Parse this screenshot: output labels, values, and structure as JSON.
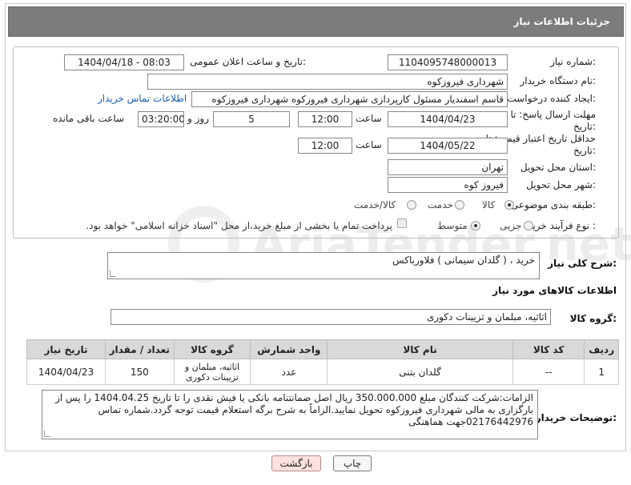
{
  "header": {
    "title": "جزئیات اطلاعات نیاز"
  },
  "form": {
    "need_number_label": "شماره نیاز:",
    "need_number": "1104095748000013",
    "announce_label": "تاریخ و ساعت اعلان عمومی:",
    "announce_value": "1404/04/18 - 08:03",
    "buyer_org_label": "نام دستگاه خریدار:",
    "buyer_org": "شهرداری فیروزکوه",
    "creator_label": "ایجاد کننده درخواست:",
    "creator": "قاسم اسفندیار مسئول کارپردازی شهرداری فیروزکوه شهرداری فیروزکوه",
    "contact_link": "اطلاعات تماس خریدار",
    "deadline_label": "مهلت ارسال پاسخ: تا تاریخ:",
    "deadline_date": "1404/04/23",
    "time_label": "ساعت",
    "deadline_time": "12:00",
    "days_value": "5",
    "days_label": "روز و",
    "remaining_time": "03:20:00",
    "remaining_label": "ساعت باقی مانده",
    "validity_label": "حداقل تاریخ اعتبار قیمت: تا تاریخ:",
    "validity_date": "1404/05/22",
    "validity_time": "12:00",
    "province_label": "استان محل تحویل:",
    "province": "تهران",
    "city_label": "شهر محل تحویل:",
    "city": "فیروز کوه",
    "category_label": "طبقه بندی موضوعی:",
    "category_options": [
      "کالا",
      "خدمت",
      "کالا/خدمت"
    ],
    "category_selected": "کالا",
    "process_label": "نوع فرآیند خرید :",
    "process_options": [
      "جزیی",
      "متوسط"
    ],
    "process_selected": "متوسط",
    "payment_note": "پرداخت تمام یا بخشی از مبلغ خرید،از محل \"اسناد خزانه اسلامی\" خواهد بود."
  },
  "description": {
    "label": "شرح کلی نیاز:",
    "value": "خرید ، ( گلدان سیمانی ) فلاورباکس"
  },
  "goods_section": {
    "title": "اطلاعات کالاهای مورد نیاز",
    "group_label": "گروه کالا:",
    "group_value": "اثاثیه، مبلمان و تزیینات دکوری"
  },
  "table": {
    "headers": [
      "ردیف",
      "کد کالا",
      "نام کالا",
      "واحد شمارش",
      "گروه کالا",
      "تعداد / مقدار",
      "تاریخ نیاز"
    ],
    "rows": [
      [
        "1",
        "--",
        "گلدان بتنی",
        "عدد",
        "اثاثیه، مبلمان و تزیینات دکوری",
        "150",
        "1404/04/23"
      ]
    ]
  },
  "buyer_notes": {
    "label": "توضیحات خریدار:",
    "value": "الزامات:شرکت کنندگان مبلغ 350.000.000 ریال اصل ضمانتنامه بانکی یا فیش نقدی را تا تاریخ 1404.04.25 را پس از بارگزاری به مالی شهرداری فیروزکوه تحویل نمایید.الزاماً به شرح برگه استعلام قیمت توجه گردد.شماره تماس 02176442976جهت هماهنگی"
  },
  "buttons": {
    "print": "چاپ",
    "back": "بازگشت"
  },
  "watermark": "AriaTender.net"
}
